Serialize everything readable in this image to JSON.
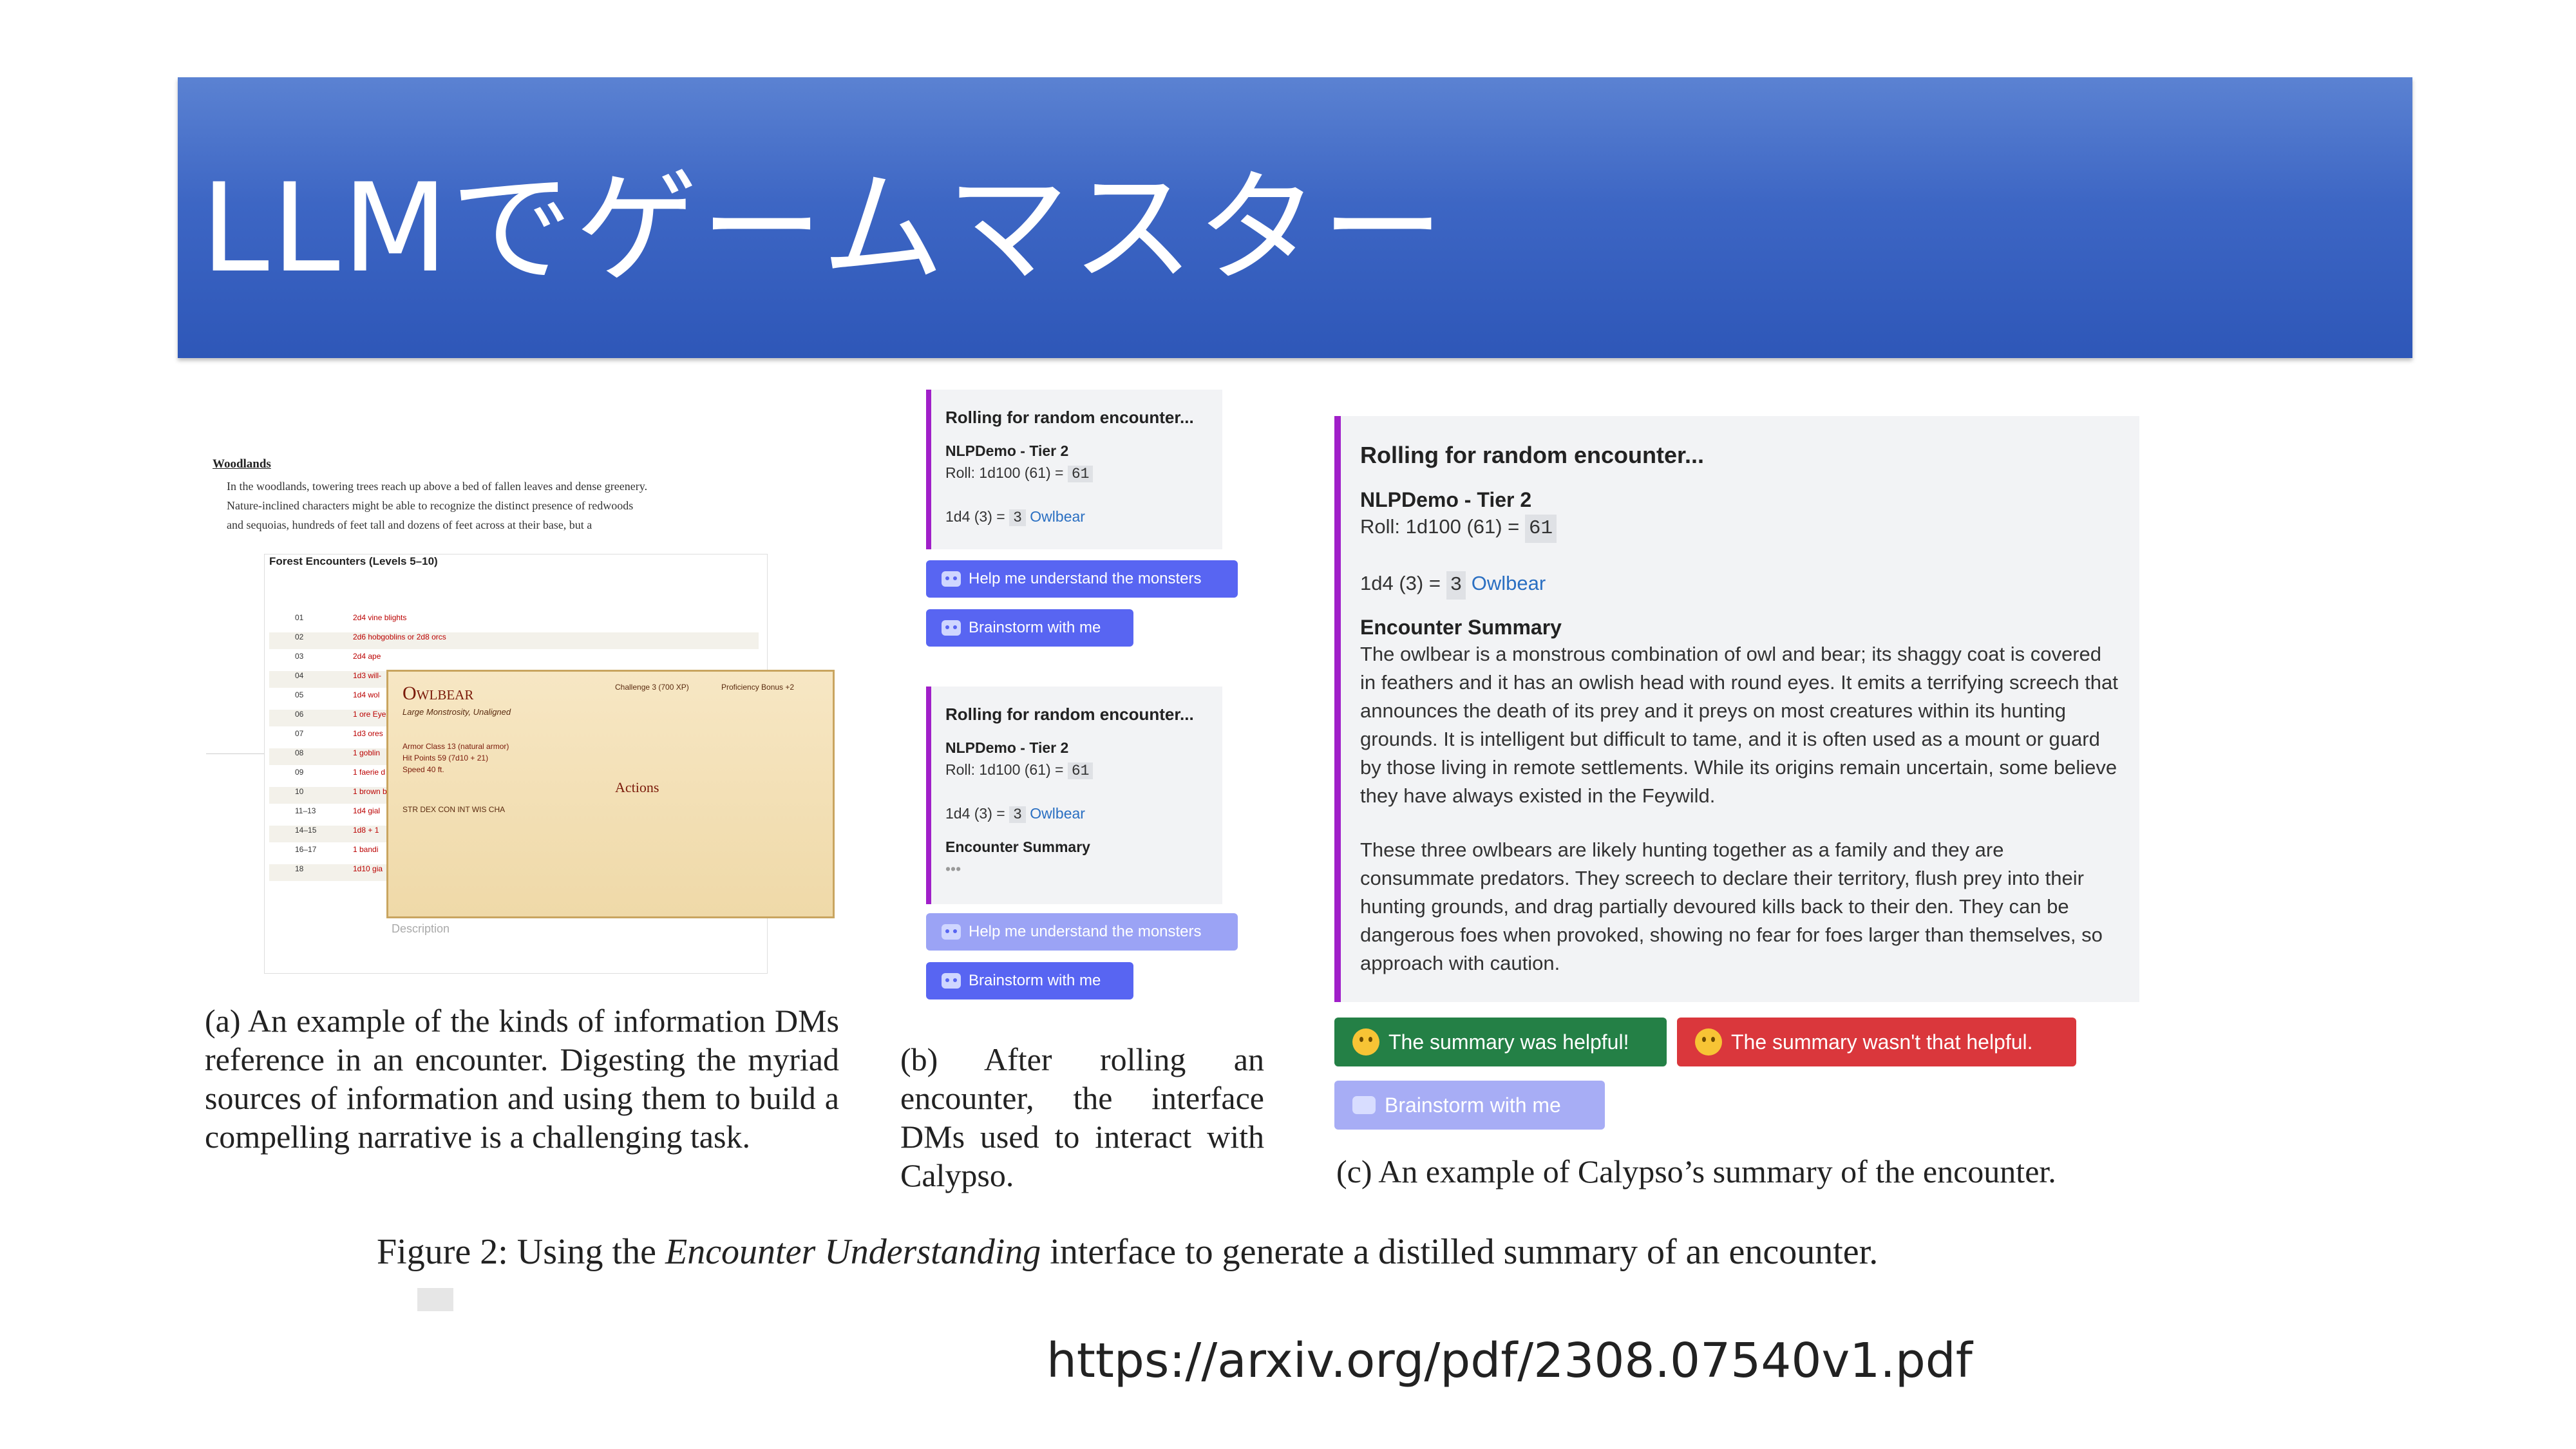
{
  "slide": {
    "title": "LLMでゲームマスター",
    "url": "https://arxiv.org/pdf/2308.07540v1.pdf"
  },
  "figure": {
    "caption_prefix": "Figure 2: Using the ",
    "caption_italic": "Encounter Understanding",
    "caption_suffix": " interface to generate a distilled summary of an encounter."
  },
  "panel_a": {
    "heading": "Woodlands",
    "body": "In the woodlands, towering trees reach up above a bed of fallen leaves and dense greenery. Nature-inclined characters might be able to recognize the distinct presence of redwoods and sequoias, hundreds of feet tall and dozens of feet across at their base, but a",
    "table_title": "Forest Encounters (Levels 5–10)",
    "table_rows": [
      {
        "n": "01",
        "e": "2d4 vine blights"
      },
      {
        "n": "02",
        "e": "2d6 hobgoblins or 2d8 orcs"
      },
      {
        "n": "03",
        "e": "2d4 ape"
      },
      {
        "n": "04",
        "e": "1d3 will-"
      },
      {
        "n": "05",
        "e": "1d4 wol"
      },
      {
        "n": "06",
        "e": "1 ore Eye"
      },
      {
        "n": "07",
        "e": "1d3 ores"
      },
      {
        "n": "08",
        "e": "1 goblin"
      },
      {
        "n": "09",
        "e": "1 faerie d"
      },
      {
        "n": "10",
        "e": "1 brown b"
      },
      {
        "n": "11–13",
        "e": "1d4 gial"
      },
      {
        "n": "14–15",
        "e": "1d8 + 1"
      },
      {
        "n": "16–17",
        "e": "1 bandi"
      },
      {
        "n": "18",
        "e": "1d10 gia"
      }
    ],
    "statblock": {
      "name": "Owlbear",
      "type": "Large Monstrosity, Unaligned",
      "challenge": "Challenge 3 (700 XP)",
      "proficiency": "Proficiency Bonus +2",
      "armor": "Armor Class 13 (natural armor)",
      "hp": "Hit Points 59 (7d10 + 21)",
      "speed": "Speed 40 ft.",
      "abilities": "STR  DEX  CON  INT  WIS  CHA",
      "actions_label": "Actions"
    },
    "description_label": "Description",
    "caption": "(a) An example of the kinds of information DMs reference in an encounter. Digesting the myriad sources of information and using them to build a compelling narrative is a challenging task."
  },
  "panel_b": {
    "card1": {
      "title": "Rolling for random encounter...",
      "subtitle": "NLPDemo - Tier 2",
      "roll_prefix": "Roll: 1d100 (61) = ",
      "roll_value": "61",
      "d4_prefix": "1d4 (3) = ",
      "d4_value": "3",
      "monster": "Owlbear"
    },
    "btn_understand": "Help me understand the monsters",
    "btn_brainstorm": "Brainstorm with me",
    "card2": {
      "title": "Rolling for random encounter...",
      "subtitle": "NLPDemo - Tier 2",
      "roll_prefix": "Roll: 1d100 (61) = ",
      "roll_value": "61",
      "d4_prefix": "1d4 (3) = ",
      "d4_value": "3",
      "monster": "Owlbear",
      "summary_label": "Encounter Summary"
    },
    "caption": "(b) After rolling an encounter, the interface DMs used to interact with Calypso."
  },
  "panel_c": {
    "title": "Rolling for random encounter...",
    "subtitle": "NLPDemo - Tier 2",
    "roll_prefix": "Roll: 1d100 (61) = ",
    "roll_value": "61",
    "d4_prefix": "1d4 (3) = ",
    "d4_value": "3",
    "monster": "Owlbear",
    "summary_label": "Encounter Summary",
    "para1": "The owlbear is a monstrous combination of owl and bear; its shaggy coat is covered in feathers and it has an owlish head with round eyes. It emits a terrifying screech that announces the death of its prey and it preys on most creatures within its hunting grounds. It is intelligent but difficult to tame, and it is often used as a mount or guard by those living in remote settlements. While its origins remain uncertain, some believe they have always existed in the Feywild.",
    "para2": "These three owlbears are likely hunting together as a family and they are consummate predators. They screech to declare their territory, flush prey into their hunting grounds, and drag partially devoured kills back to their den. They can be dangerous foes when provoked, showing no fear for foes larger than themselves, so approach with caution.",
    "btn_helpful": "The summary was helpful!",
    "btn_unhelpful": "The summary wasn't that helpful.",
    "btn_brainstorm": "Brainstorm with me",
    "caption": "(c) An example of Calypso’s summary of the encounter."
  },
  "colors": {
    "banner": "#3d66c4",
    "accent_bar": "#a01fc9",
    "blurple": "#5865f2",
    "green": "#248046",
    "red": "#da373c"
  }
}
